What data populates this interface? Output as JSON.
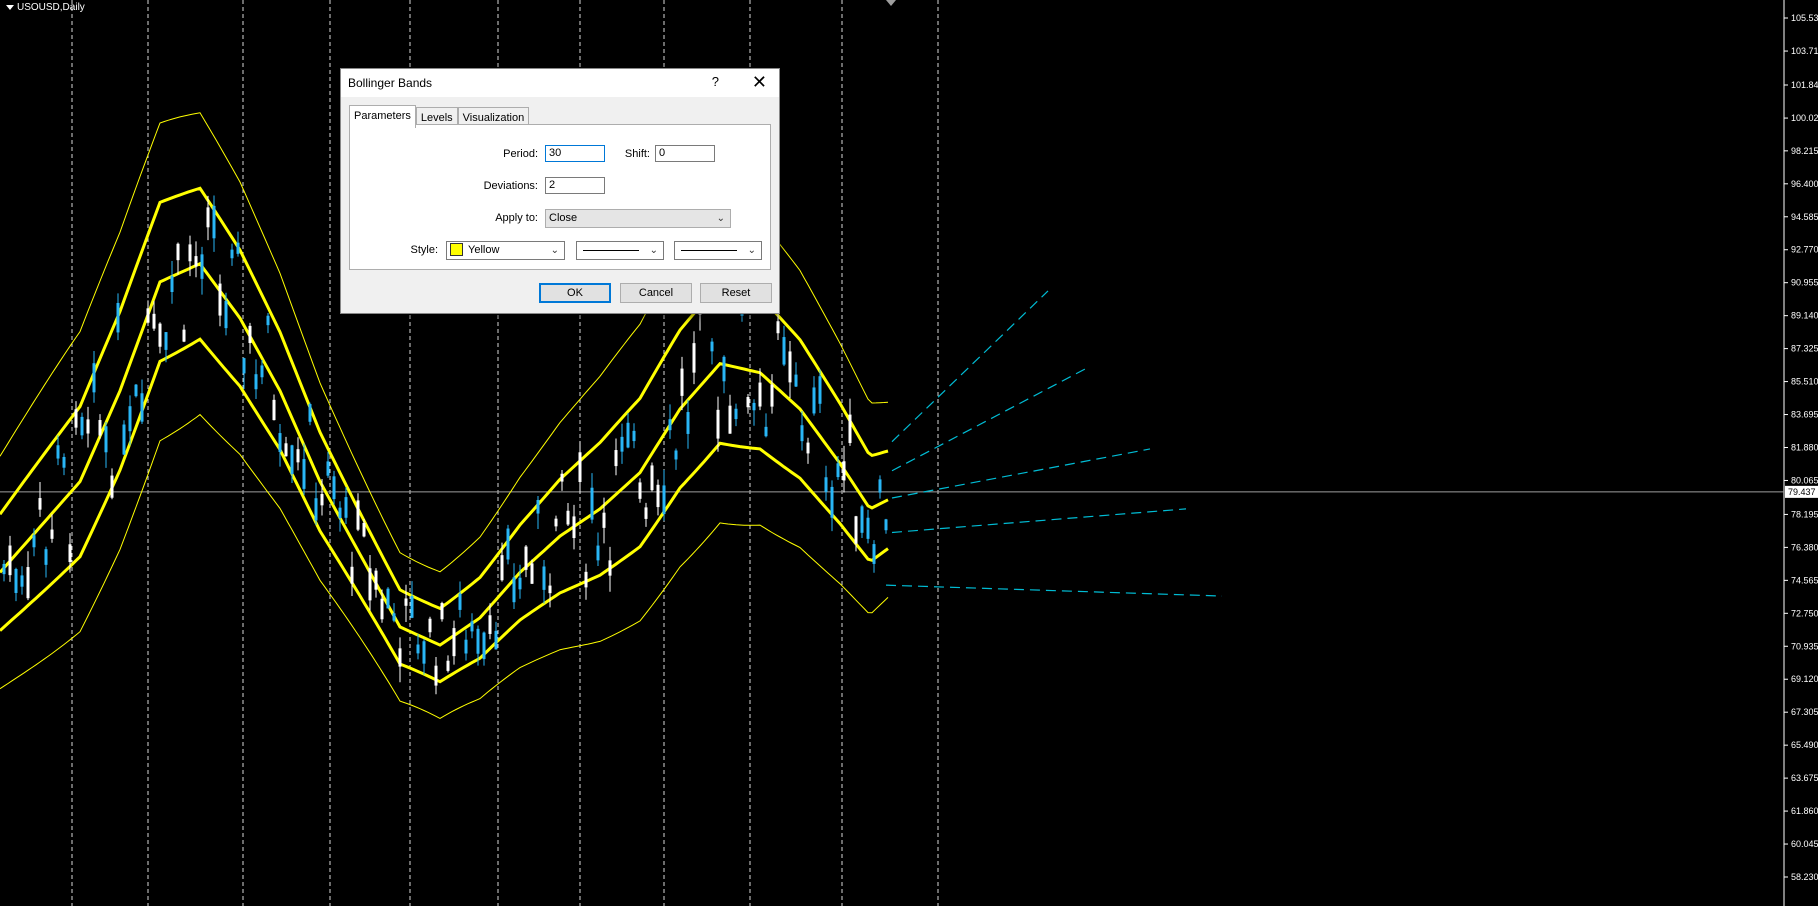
{
  "chart": {
    "symbol_label": "USOUSD,Daily",
    "background": "#000000",
    "candle_up_color": "#29b6f6",
    "candle_down_color": "#ffffff",
    "band_color": "#ffff00",
    "trendline_color": "#00bcd4",
    "current_price": "79.437",
    "price_axis": [
      "105.53",
      "103.71",
      "101.84",
      "100.02",
      "98.215",
      "96.400",
      "94.585",
      "92.770",
      "90.955",
      "89.140",
      "87.325",
      "85.510",
      "83.695",
      "81.880",
      "80.065",
      "78.195",
      "76.380",
      "74.565",
      "72.750",
      "70.935",
      "69.120",
      "67.305",
      "65.490",
      "63.675",
      "61.860",
      "60.045",
      "58.230"
    ]
  },
  "dialog": {
    "title": "Bollinger Bands",
    "help_symbol": "?",
    "close_symbol": "✕",
    "tabs": [
      {
        "label": "Parameters",
        "active": true
      },
      {
        "label": "Levels",
        "active": false
      },
      {
        "label": "Visualization",
        "active": false
      }
    ],
    "period_label": "Period:",
    "period_value": "30",
    "shift_label": "Shift:",
    "shift_value": "0",
    "deviations_label": "Deviations:",
    "deviations_value": "2",
    "apply_label": "Apply to:",
    "apply_value": "Close",
    "style_label": "Style:",
    "style_color_name": "Yellow",
    "style_color_hex": "#ffff00",
    "ok_label": "OK",
    "cancel_label": "Cancel",
    "reset_label": "Reset"
  }
}
